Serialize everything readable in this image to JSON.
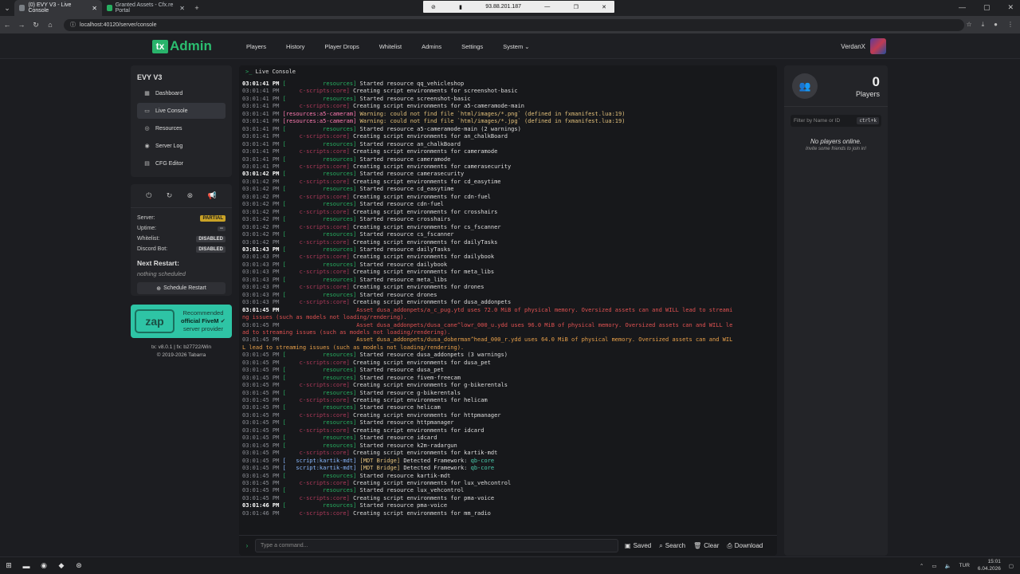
{
  "browser": {
    "tab1": "(0) EVY V3 - Live Console",
    "tab2": "Granted Assets - Cfx.re Portal",
    "url": "localhost:40120/server/console",
    "rdp_ip": "93.88.201.187"
  },
  "nav": {
    "logo_box": "tx",
    "logo_text": "Admin",
    "items": [
      "Players",
      "History",
      "Player Drops",
      "Whitelist",
      "Admins",
      "Settings",
      "System ⌄"
    ],
    "user": "VerdanX"
  },
  "sidebar": {
    "server_name": "EVY V3",
    "items": [
      "Dashboard",
      "Live Console",
      "Resources",
      "Server Log",
      "CFG Editor"
    ]
  },
  "status": {
    "server_label": "Server:",
    "server_value": "PARTIAL",
    "uptime_label": "Uptime:",
    "uptime_value": "--",
    "whitelist_label": "Whitelist:",
    "whitelist_value": "DISABLED",
    "discord_label": "Discord Bot:",
    "discord_value": "DISABLED",
    "next_restart": "Next Restart:",
    "nothing": "nothing scheduled",
    "schedule_btn": "Schedule Restart"
  },
  "zap": {
    "logo": "zap",
    "line1": "Recommended",
    "line2": "official FiveM",
    "line3": "server provider"
  },
  "version": {
    "line1": "tx: v8.0.1 | fx: b27722/Win",
    "line2": "© 2019-2026 Tabarra"
  },
  "console": {
    "title": "Live Console",
    "placeholder": "Type a command...",
    "actions": [
      "Saved",
      "Search",
      "Clear",
      "Download"
    ],
    "lines": [
      {
        "t": "03:01:41 PM",
        "bold": true,
        "tag": "[           resources]",
        "tc": "res",
        "msg": "Started resource qq_vehicleshop"
      },
      {
        "t": "03:01:41 PM",
        "tag": "     c-scripts:core]",
        "tc": "ss",
        "msg": "Creating script environments for screenshot-basic"
      },
      {
        "t": "03:01:41 PM",
        "tag": "[           resources]",
        "tc": "res",
        "msg": "Started resource screenshot-basic"
      },
      {
        "t": "03:01:41 PM",
        "tag": "     c-scripts:core]",
        "tc": "ss",
        "msg": "Creating script environments for a5-cameramode-main"
      },
      {
        "t": "03:01:41 PM",
        "tag": "[resources:a5-cameram]",
        "tc": "cam",
        "msg": "Warning: could not find file `html/images/*.png` (defined in fxmanifest.lua:19)",
        "mc": "warn"
      },
      {
        "t": "03:01:41 PM",
        "tag": "[resources:a5-cameram]",
        "tc": "cam",
        "msg": "Warning: could not find file `html/images/*.jpg` (defined in fxmanifest.lua:19)",
        "mc": "warn"
      },
      {
        "t": "03:01:41 PM",
        "tag": "[           resources]",
        "tc": "res",
        "msg": "Started resource a5-cameramode-main (2 warnings)"
      },
      {
        "t": "03:01:41 PM",
        "tag": "     c-scripts:core]",
        "tc": "ss",
        "msg": "Creating script environments for an_chalkBoard"
      },
      {
        "t": "03:01:41 PM",
        "tag": "[           resources]",
        "tc": "res",
        "msg": "Started resource an_chalkBoard"
      },
      {
        "t": "03:01:41 PM",
        "tag": "     c-scripts:core]",
        "tc": "ss",
        "msg": "Creating script environments for cameramode"
      },
      {
        "t": "03:01:41 PM",
        "tag": "[           resources]",
        "tc": "res",
        "msg": "Started resource cameramode"
      },
      {
        "t": "03:01:41 PM",
        "tag": "     c-scripts:core]",
        "tc": "ss",
        "msg": "Creating script environments for camerasecurity"
      },
      {
        "t": "03:01:42 PM",
        "bold": true,
        "tag": "[           resources]",
        "tc": "res",
        "msg": "Started resource camerasecurity"
      },
      {
        "t": "03:01:42 PM",
        "tag": "     c-scripts:core]",
        "tc": "ss",
        "msg": "Creating script environments for cd_easytime"
      },
      {
        "t": "03:01:42 PM",
        "tag": "[           resources]",
        "tc": "res",
        "msg": "Started resource cd_easytime"
      },
      {
        "t": "03:01:42 PM",
        "tag": "     c-scripts:core]",
        "tc": "ss",
        "msg": "Creating script environments for cdn-fuel"
      },
      {
        "t": "03:01:42 PM",
        "tag": "[           resources]",
        "tc": "res",
        "msg": "Started resource cdn-fuel"
      },
      {
        "t": "03:01:42 PM",
        "tag": "     c-scripts:core]",
        "tc": "ss",
        "msg": "Creating script environments for crosshairs"
      },
      {
        "t": "03:01:42 PM",
        "tag": "[           resources]",
        "tc": "res",
        "msg": "Started resource crosshairs"
      },
      {
        "t": "03:01:42 PM",
        "tag": "     c-scripts:core]",
        "tc": "ss",
        "msg": "Creating script environments for cs_fscanner"
      },
      {
        "t": "03:01:42 PM",
        "tag": "[           resources]",
        "tc": "res",
        "msg": "Started resource cs_fscanner"
      },
      {
        "t": "03:01:42 PM",
        "tag": "     c-scripts:core]",
        "tc": "ss",
        "msg": "Creating script environments for dailyTasks"
      },
      {
        "t": "03:01:43 PM",
        "bold": true,
        "tag": "[           resources]",
        "tc": "res",
        "msg": "Started resource dailyTasks"
      },
      {
        "t": "03:01:43 PM",
        "tag": "     c-scripts:core]",
        "tc": "ss",
        "msg": "Creating script environments for dailybook"
      },
      {
        "t": "03:01:43 PM",
        "tag": "[           resources]",
        "tc": "res",
        "msg": "Started resource dailybook"
      },
      {
        "t": "03:01:43 PM",
        "tag": "     c-scripts:core]",
        "tc": "ss",
        "msg": "Creating script environments for meta_libs"
      },
      {
        "t": "03:01:43 PM",
        "tag": "[           resources]",
        "tc": "res",
        "msg": "Started resource meta_libs"
      },
      {
        "t": "03:01:43 PM",
        "tag": "     c-scripts:core]",
        "tc": "ss",
        "msg": "Creating script environments for drones"
      },
      {
        "t": "03:01:43 PM",
        "tag": "[           resources]",
        "tc": "res",
        "msg": "Started resource drones"
      },
      {
        "t": "03:01:43 PM",
        "tag": "     c-scripts:core]",
        "tc": "ss",
        "msg": "Creating script environments for dusa_addonpets"
      },
      {
        "t": "03:01:45 PM",
        "bold": true,
        "tag": "                     ",
        "tc": "res",
        "msg": "Asset dusa_addonpets/a_c_pug.ytd uses 72.0 MiB of physical memory. Oversized assets can and WILL lead to streami",
        "mc": "err"
      },
      {
        "t": "",
        "tag": "",
        "tc": "res",
        "msg": "ng issues (such as models not loading/rendering).",
        "mc": "err"
      },
      {
        "t": "03:01:45 PM",
        "tag": "                     ",
        "tc": "res",
        "msg": "Asset dusa_addonpets/dusa_cane^lowr_000_u.ydd uses 96.0 MiB of physical memory. Oversized assets can and WILL le",
        "mc": "err"
      },
      {
        "t": "",
        "tag": "",
        "tc": "res",
        "msg": "ad to streaming issues (such as models not loading/rendering).",
        "mc": "err"
      },
      {
        "t": "03:01:45 PM",
        "tag": "                     ",
        "tc": "res",
        "msg": "Asset dusa_addonpets/dusa_doberman^head_000_r.ydd uses 64.0 MiB of physical memory. Oversized assets can and WIL",
        "mc": "orange"
      },
      {
        "t": "",
        "tag": "",
        "tc": "res",
        "msg": "L lead to streaming issues (such as models not loading/rendering).",
        "mc": "orange"
      },
      {
        "t": "03:01:45 PM",
        "tag": "[           resources]",
        "tc": "res",
        "msg": "Started resource dusa_addonpets (3 warnings)"
      },
      {
        "t": "03:01:45 PM",
        "tag": "     c-scripts:core]",
        "tc": "ss",
        "msg": "Creating script environments for dusa_pet"
      },
      {
        "t": "03:01:45 PM",
        "tag": "[           resources]",
        "tc": "res",
        "msg": "Started resource dusa_pet"
      },
      {
        "t": "03:01:45 PM",
        "tag": "[           resources]",
        "tc": "res",
        "msg": "Started resource fivem-freecam"
      },
      {
        "t": "03:01:45 PM",
        "tag": "     c-scripts:core]",
        "tc": "ss",
        "msg": "Creating script environments for g-bikerentals"
      },
      {
        "t": "03:01:45 PM",
        "tag": "[           resources]",
        "tc": "res",
        "msg": "Started resource g-bikerentals"
      },
      {
        "t": "03:01:45 PM",
        "tag": "     c-scripts:core]",
        "tc": "ss",
        "msg": "Creating script environments for helicam"
      },
      {
        "t": "03:01:45 PM",
        "tag": "[           resources]",
        "tc": "res",
        "msg": "Started resource helicam"
      },
      {
        "t": "03:01:45 PM",
        "tag": "     c-scripts:core]",
        "tc": "ss",
        "msg": "Creating script environments for httpmanager"
      },
      {
        "t": "03:01:45 PM",
        "tag": "[           resources]",
        "tc": "res",
        "msg": "Started resource httpmanager"
      },
      {
        "t": "03:01:45 PM",
        "tag": "     c-scripts:core]",
        "tc": "ss",
        "msg": "Creating script environments for idcard"
      },
      {
        "t": "03:01:45 PM",
        "tag": "[           resources]",
        "tc": "res",
        "msg": "Started resource idcard"
      },
      {
        "t": "03:01:45 PM",
        "tag": "[           resources]",
        "tc": "res",
        "msg": "Started resource k2m-radargun"
      },
      {
        "t": "03:01:45 PM",
        "tag": "     c-scripts:core]",
        "tc": "ss",
        "msg": "Creating script environments for kartik-mdt"
      },
      {
        "t": "03:01:45 PM",
        "tag": "[   script:kartik-mdt]",
        "tc": "kartik",
        "msg": "[MDT Bridge] Detected Framework: qb-core",
        "mdt": true
      },
      {
        "t": "03:01:45 PM",
        "tag": "[   script:kartik-mdt]",
        "tc": "kartik",
        "msg": "[MDT Bridge] Detected Framework: qb-core",
        "mdt": true
      },
      {
        "t": "03:01:45 PM",
        "tag": "[           resources]",
        "tc": "res",
        "msg": "Started resource kartik-mdt"
      },
      {
        "t": "03:01:45 PM",
        "tag": "     c-scripts:core]",
        "tc": "ss",
        "msg": "Creating script environments for lux_vehcontrol"
      },
      {
        "t": "03:01:45 PM",
        "tag": "[           resources]",
        "tc": "res",
        "msg": "Started resource lux_vehcontrol"
      },
      {
        "t": "03:01:45 PM",
        "tag": "     c-scripts:core]",
        "tc": "ss",
        "msg": "Creating script environments for pma-voice"
      },
      {
        "t": "03:01:46 PM",
        "bold": true,
        "tag": "[           resources]",
        "tc": "res",
        "msg": "Started resource pma-voice"
      },
      {
        "t": "03:01:46 PM",
        "tag": "     c-scripts:core]",
        "tc": "ss",
        "msg": "Creating script environments for mm_radio"
      }
    ]
  },
  "players": {
    "count": "0",
    "label": "Players",
    "filter_placeholder": "Filter by Name or ID",
    "kbd": "ctrl+k",
    "empty": "No players online.",
    "invite": "Invite some friends to join in!"
  },
  "taskbar": {
    "lang": "TUR",
    "time": "15:01",
    "date": "6.04.2026"
  }
}
